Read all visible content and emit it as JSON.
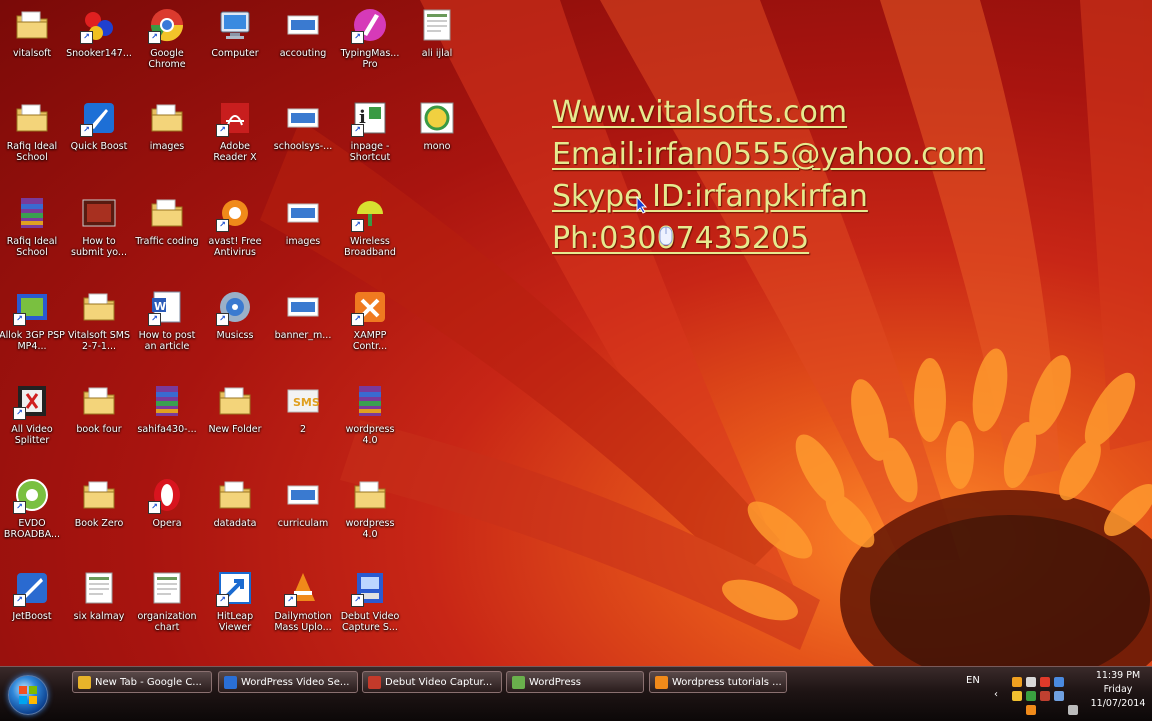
{
  "desktop": {
    "icons": [
      {
        "label": "vitalsoft",
        "icon": "folder-icon",
        "col": 0,
        "row": 0
      },
      {
        "label": "Snooker147...",
        "icon": "snooker-icon",
        "col": 1,
        "row": 0
      },
      {
        "label": "Google Chrome",
        "icon": "chrome-icon",
        "col": 2,
        "row": 0
      },
      {
        "label": "Computer",
        "icon": "computer-icon",
        "col": 3,
        "row": 0
      },
      {
        "label": "accouting",
        "icon": "image-file-icon",
        "col": 4,
        "row": 0
      },
      {
        "label": "TypingMas... Pro",
        "icon": "typingmaster-icon",
        "col": 5,
        "row": 0
      },
      {
        "label": "ali ijlal",
        "icon": "document-thumb-icon",
        "col": 6,
        "row": 0
      },
      {
        "label": "Rafiq Ideal School",
        "icon": "folder-icon",
        "col": 0,
        "row": 1
      },
      {
        "label": "Quick Boost",
        "icon": "quickboost-icon",
        "col": 1,
        "row": 1
      },
      {
        "label": "images",
        "icon": "folder-icon",
        "col": 2,
        "row": 1
      },
      {
        "label": "Adobe Reader X",
        "icon": "adobe-reader-icon",
        "col": 3,
        "row": 1
      },
      {
        "label": "schoolsys-...",
        "icon": "image-file-icon",
        "col": 4,
        "row": 1
      },
      {
        "label": "inpage - Shortcut",
        "icon": "inpage-icon",
        "col": 5,
        "row": 1
      },
      {
        "label": "mono",
        "icon": "mono-icon",
        "col": 6,
        "row": 1
      },
      {
        "label": "Rafiq Ideal School",
        "icon": "winrar-icon",
        "col": 0,
        "row": 2
      },
      {
        "label": "How to submit yo...",
        "icon": "video-thumb-icon",
        "col": 1,
        "row": 2
      },
      {
        "label": "Traffic coding",
        "icon": "folder-icon",
        "col": 2,
        "row": 2
      },
      {
        "label": "avast! Free Antivirus",
        "icon": "avast-icon",
        "col": 3,
        "row": 2
      },
      {
        "label": "images",
        "icon": "image-file-icon",
        "col": 4,
        "row": 2
      },
      {
        "label": "Wireless Broadband",
        "icon": "wireless-icon",
        "col": 5,
        "row": 2
      },
      {
        "label": "Allok 3GP PSP MP4...",
        "icon": "allok-icon",
        "col": 0,
        "row": 3
      },
      {
        "label": "Vitalsoft SMS 2-7-1...",
        "icon": "folder-icon",
        "col": 1,
        "row": 3
      },
      {
        "label": "How to post an article",
        "icon": "word-doc-icon",
        "col": 2,
        "row": 3
      },
      {
        "label": "Musicss",
        "icon": "music-icon",
        "col": 3,
        "row": 3
      },
      {
        "label": "banner_m...",
        "icon": "image-file-icon",
        "col": 4,
        "row": 3
      },
      {
        "label": "XAMPP Contr...",
        "icon": "xampp-icon",
        "col": 5,
        "row": 3
      },
      {
        "label": "All Video Splitter",
        "icon": "video-splitter-icon",
        "col": 0,
        "row": 4
      },
      {
        "label": "book four",
        "icon": "folder-icon",
        "col": 1,
        "row": 4
      },
      {
        "label": "sahifa430-...",
        "icon": "winrar-icon",
        "col": 2,
        "row": 4
      },
      {
        "label": "New Folder",
        "icon": "folder-icon",
        "col": 3,
        "row": 4
      },
      {
        "label": "2",
        "icon": "sms-image-icon",
        "col": 4,
        "row": 4
      },
      {
        "label": "wordpress 4.0",
        "icon": "winrar-icon",
        "col": 5,
        "row": 4
      },
      {
        "label": "EVDO BROADBA...",
        "icon": "evdo-icon",
        "col": 0,
        "row": 5
      },
      {
        "label": "Book Zero",
        "icon": "folder-icon",
        "col": 1,
        "row": 5
      },
      {
        "label": "Opera",
        "icon": "opera-icon",
        "col": 2,
        "row": 5
      },
      {
        "label": "datadata",
        "icon": "folder-icon",
        "col": 3,
        "row": 5
      },
      {
        "label": "curriculam",
        "icon": "image-file-icon",
        "col": 4,
        "row": 5
      },
      {
        "label": "wordpress 4.0",
        "icon": "folder-icon",
        "col": 5,
        "row": 5
      },
      {
        "label": "JetBoost",
        "icon": "jetboost-icon",
        "col": 0,
        "row": 6
      },
      {
        "label": "six kalmay",
        "icon": "document-thumb-icon",
        "col": 1,
        "row": 6
      },
      {
        "label": "organization chart",
        "icon": "document-thumb-icon",
        "col": 2,
        "row": 6
      },
      {
        "label": "HitLeap Viewer",
        "icon": "hitleap-icon",
        "col": 3,
        "row": 6
      },
      {
        "label": "Dailymotion Mass Uplo...",
        "icon": "vlc-icon",
        "col": 4,
        "row": 6
      },
      {
        "label": "Debut Video Capture S...",
        "icon": "debut-icon",
        "col": 5,
        "row": 6
      }
    ]
  },
  "contact": {
    "website": "Www.vitalsofts.com",
    "email": "Email:irfan0555@yahoo.com",
    "skype": "Skype ID:irfanpkirfan",
    "phone": "Ph:03007435205"
  },
  "taskbar": {
    "buttons": [
      {
        "label": "New Tab - Google C...",
        "icon": "chrome-icon",
        "color": "#e8b32a"
      },
      {
        "label": "WordPress Video Se...",
        "icon": "wordpress-icon",
        "color": "#2a6fd6"
      },
      {
        "label": "Debut Video Captur...",
        "icon": "debut-icon",
        "color": "#c43a2a"
      },
      {
        "label": "WordPress",
        "icon": "notepad-icon",
        "color": "#6ab04c"
      },
      {
        "label": "Wordpress tutorials ...",
        "icon": "vlc-icon",
        "color": "#f08a1a"
      }
    ],
    "language": "EN",
    "clock": {
      "time": "11:39 PM",
      "day": "Friday",
      "date": "11/07/2014"
    }
  }
}
